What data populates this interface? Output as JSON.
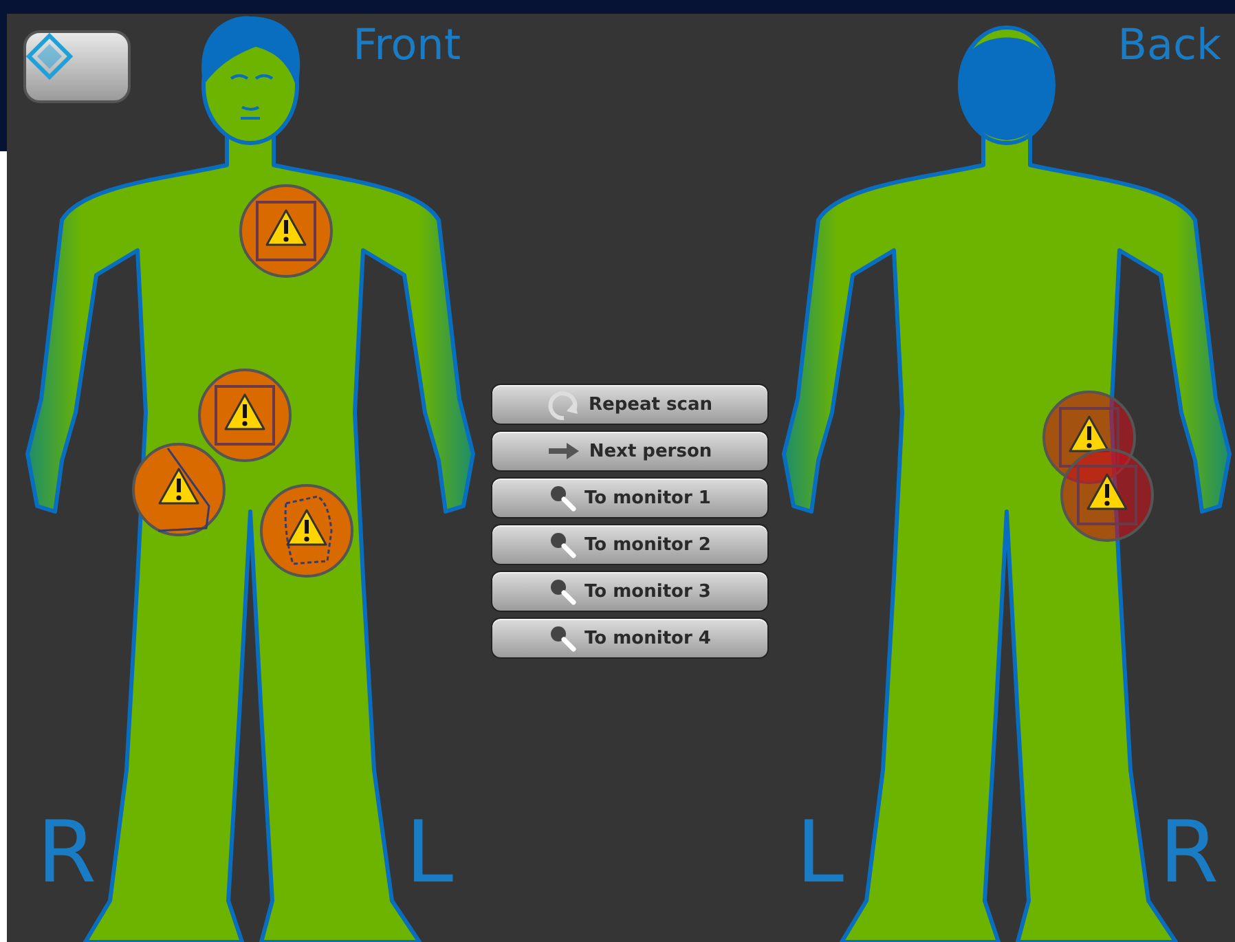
{
  "front": {
    "title": "Front",
    "side_left": "R",
    "side_right": "L",
    "alerts": [
      {
        "kind": "box",
        "critical": false
      },
      {
        "kind": "box",
        "critical": false
      },
      {
        "kind": "polygon",
        "critical": false
      },
      {
        "kind": "blob",
        "critical": false
      }
    ]
  },
  "actions": [
    {
      "label": "Repeat scan",
      "kind": "repeat"
    },
    {
      "label": "Next person",
      "kind": "next"
    },
    {
      "label": "To monitor 1",
      "kind": "monitor"
    },
    {
      "label": "To monitor 2",
      "kind": "monitor"
    },
    {
      "label": "To monitor 3",
      "kind": "monitor"
    },
    {
      "label": "To monitor 4",
      "kind": "monitor"
    }
  ],
  "back": {
    "title": "Back",
    "side_left": "L",
    "side_right": "R",
    "alerts": [
      {
        "kind": "box",
        "critical": true
      },
      {
        "kind": "box",
        "critical": true
      }
    ]
  }
}
